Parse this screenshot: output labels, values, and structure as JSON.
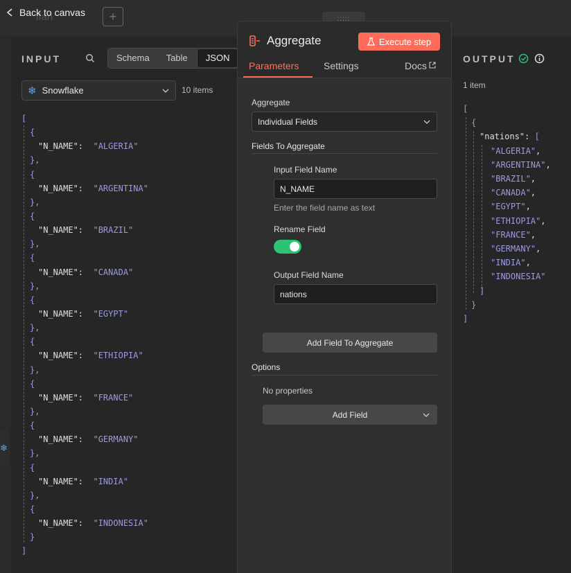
{
  "topbar": {
    "back_label": "Back to canvas",
    "bg_node_text": "ifan"
  },
  "input": {
    "title": "INPUT",
    "view_tabs": [
      "Schema",
      "Table",
      "JSON"
    ],
    "active_view": "JSON",
    "node_name": "Snowflake",
    "items_count": "10 items",
    "items": [
      {
        "key": "\"N_NAME\"",
        "value": "\"ALGERIA\""
      },
      {
        "key": "\"N_NAME\"",
        "value": "\"ARGENTINA\""
      },
      {
        "key": "\"N_NAME\"",
        "value": "\"BRAZIL\""
      },
      {
        "key": "\"N_NAME\"",
        "value": "\"CANADA\""
      },
      {
        "key": "\"N_NAME\"",
        "value": "\"EGYPT\""
      },
      {
        "key": "\"N_NAME\"",
        "value": "\"ETHIOPIA\""
      },
      {
        "key": "\"N_NAME\"",
        "value": "\"FRANCE\""
      },
      {
        "key": "\"N_NAME\"",
        "value": "\"GERMANY\""
      },
      {
        "key": "\"N_NAME\"",
        "value": "\"INDIA\""
      },
      {
        "key": "\"N_NAME\"",
        "value": "\"INDONESIA\""
      }
    ]
  },
  "node": {
    "title": "Aggregate",
    "execute_label": "Execute step",
    "tabs": {
      "parameters": "Parameters",
      "settings": "Settings",
      "docs": "Docs"
    },
    "params": {
      "aggregate_label": "Aggregate",
      "aggregate_value": "Individual Fields",
      "fields_section": "Fields To Aggregate",
      "input_field_label": "Input Field Name",
      "input_field_value": "N_NAME",
      "input_field_hint": "Enter the field name as text",
      "rename_label": "Rename Field",
      "rename_on": true,
      "output_field_label": "Output Field Name",
      "output_field_value": "nations",
      "add_field_aggregate": "Add Field To Aggregate",
      "options_section": "Options",
      "no_properties": "No properties",
      "add_field": "Add Field"
    }
  },
  "output": {
    "title": "OUTPUT",
    "items_count": "1 item",
    "key": "\"nations\"",
    "values": [
      "\"ALGERIA\"",
      "\"ARGENTINA\"",
      "\"BRAZIL\"",
      "\"CANADA\"",
      "\"EGYPT\"",
      "\"ETHIOPIA\"",
      "\"FRANCE\"",
      "\"GERMANY\"",
      "\"INDIA\"",
      "\"INDONESIA\""
    ]
  },
  "colors": {
    "accent": "#ff6d5a",
    "toggle_on": "#2ec275",
    "json_string": "#9b9be0",
    "success": "#2ec275"
  }
}
